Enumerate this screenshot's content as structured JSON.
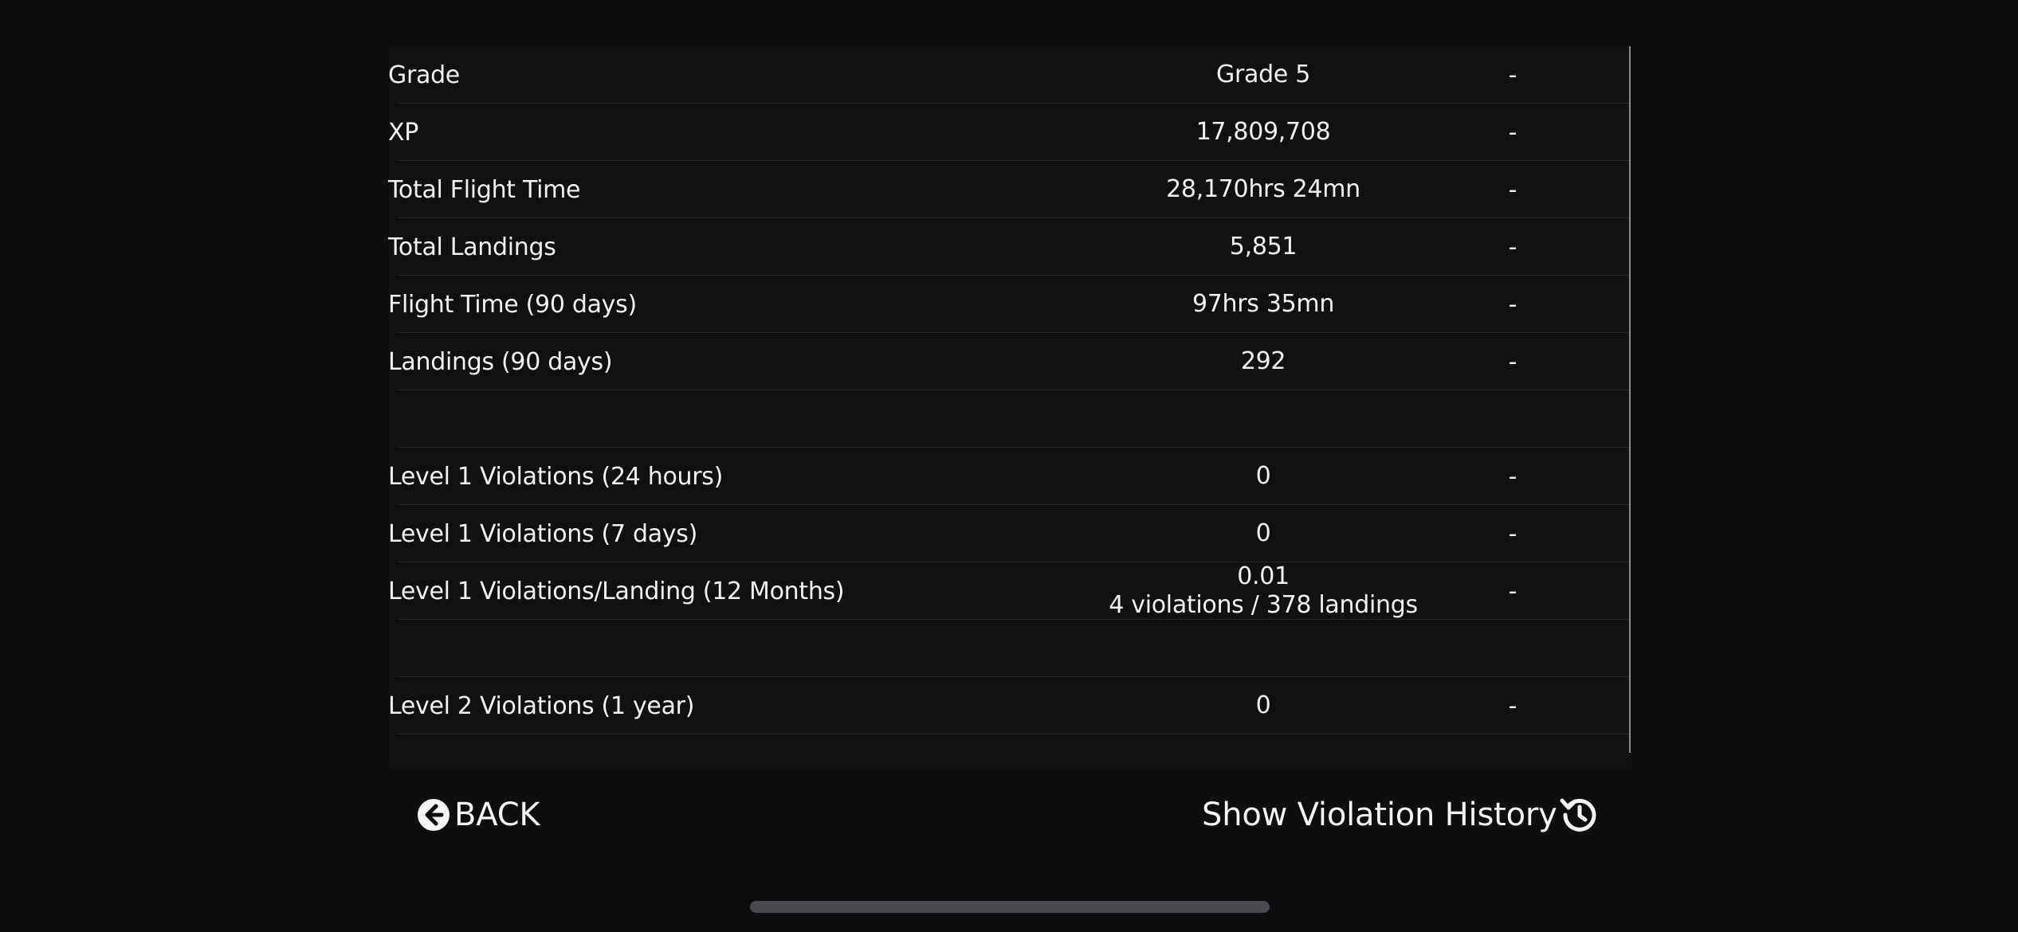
{
  "rows": [
    {
      "label": "Grade",
      "value": "Grade 5",
      "value2": "",
      "delta": "-"
    },
    {
      "label": "XP",
      "value": "17,809,708",
      "value2": "",
      "delta": "-"
    },
    {
      "label": "Total Flight Time",
      "value": "28,170hrs 24mn",
      "value2": "",
      "delta": "-"
    },
    {
      "label": "Total Landings",
      "value": "5,851",
      "value2": "",
      "delta": "-"
    },
    {
      "label": "Flight Time (90 days)",
      "value": "97hrs 35mn",
      "value2": "",
      "delta": "-"
    },
    {
      "label": "Landings (90 days)",
      "value": "292",
      "value2": "",
      "delta": "-"
    },
    {
      "label": "",
      "value": "",
      "value2": "",
      "delta": ""
    },
    {
      "label": "Level 1 Violations (24 hours)",
      "value": "0",
      "value2": "",
      "delta": "-"
    },
    {
      "label": "Level 1 Violations (7 days)",
      "value": "0",
      "value2": "",
      "delta": "-"
    },
    {
      "label": "Level 1 Violations/Landing (12 Months)",
      "value": "0.01",
      "value2": "4 violations / 378 landings",
      "delta": "-"
    },
    {
      "label": "",
      "value": "",
      "value2": "",
      "delta": ""
    },
    {
      "label": "Level 2 Violations (1 year)",
      "value": "0",
      "value2": "",
      "delta": "-"
    }
  ],
  "buttons": {
    "back_label": "BACK",
    "back_icon": "arrow-left-circle-icon",
    "history_label": "Show Violation History",
    "history_icon": "history-icon"
  }
}
